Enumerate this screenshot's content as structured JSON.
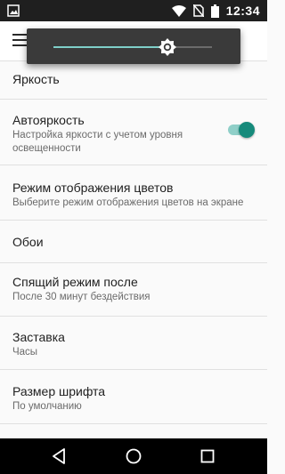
{
  "status_bar": {
    "time": "12:34",
    "icons": [
      "image-notification-icon",
      "wifi-icon",
      "no-sim-icon",
      "battery-icon"
    ]
  },
  "app_bar": {
    "menu_icon": "hamburger-menu-icon"
  },
  "brightness_popup": {
    "level_fraction": 0.6,
    "icon": "brightness-sun-icon"
  },
  "settings": {
    "brightness": {
      "title": "Яркость"
    },
    "auto_brightness": {
      "title": "Автояркость",
      "summary_line1": "Настройка яркости с учетом уровня",
      "summary_line2": "освещенности",
      "enabled": true
    },
    "color_mode": {
      "title": "Режим отображения цветов",
      "summary": "Выберите режим отображения цветов на экране"
    },
    "wallpaper": {
      "title": "Обои"
    },
    "sleep": {
      "title": "Спящий режим после",
      "summary": "После 30 минут бездействия"
    },
    "screensaver": {
      "title": "Заставка",
      "summary": "Часы"
    },
    "font_size": {
      "title": "Размер шрифта",
      "summary": "По умолчанию"
    }
  },
  "nav_bar": {
    "icons": [
      "back-icon",
      "home-icon",
      "recents-icon"
    ]
  },
  "colors": {
    "accent": "#168a7b",
    "status_bar": "#1f1f1f",
    "nav_bar": "#000000"
  }
}
